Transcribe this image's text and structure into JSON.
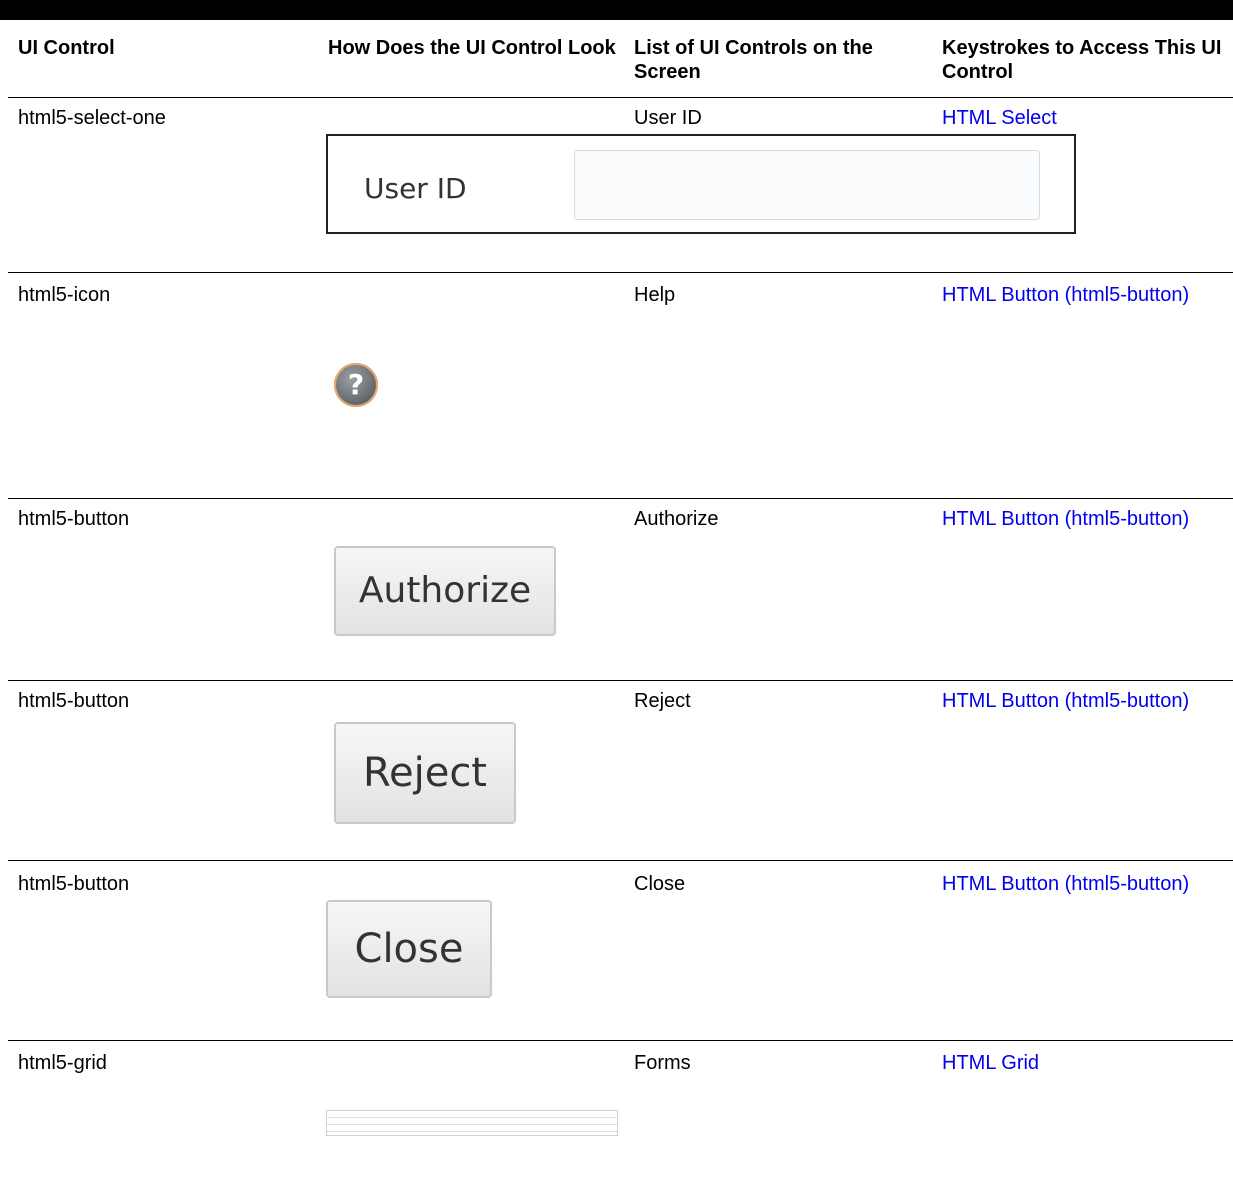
{
  "headers": {
    "col1": "UI Control",
    "col2": "How Does the UI Control Look",
    "col3": "List of UI Controls on the Screen",
    "col4": "Keystrokes to Access This UI Control"
  },
  "rows": [
    {
      "control": "html5-select-one",
      "screen_name": "User ID",
      "keystroke": "HTML Select"
    },
    {
      "control": "html5-icon",
      "screen_name": "Help",
      "keystroke": "HTML Button (html5-button)"
    },
    {
      "control": "html5-button",
      "screen_name": "Authorize",
      "keystroke": "HTML Button (html5-button)"
    },
    {
      "control": "html5-button",
      "screen_name": "Reject",
      "keystroke": "HTML Button (html5-button)"
    },
    {
      "control": "html5-button",
      "screen_name": "Close",
      "keystroke": "HTML Button (html5-button)"
    },
    {
      "control": "html5-grid",
      "screen_name": "Forms",
      "keystroke": "HTML Grid"
    }
  ],
  "images": {
    "user_id_label": "User ID",
    "help_glyph": "?",
    "authorize_label": "Authorize",
    "reject_label": "Reject",
    "close_label": "Close",
    "help_icon": "question-circle-icon"
  },
  "colors": {
    "link": "#0000ee",
    "rule": "#000000"
  }
}
